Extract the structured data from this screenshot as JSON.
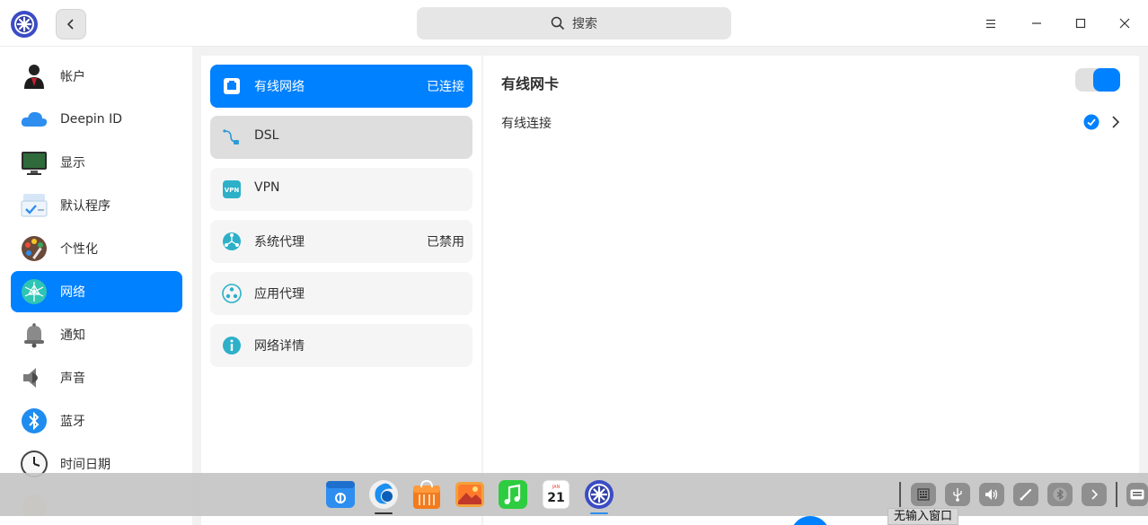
{
  "search": {
    "placeholder": "搜索"
  },
  "sidebar": {
    "items": [
      {
        "label": "帐户",
        "icon": "account-icon"
      },
      {
        "label": "Deepin ID",
        "icon": "cloud-icon"
      },
      {
        "label": "显示",
        "icon": "display-icon"
      },
      {
        "label": "默认程序",
        "icon": "default-apps-icon"
      },
      {
        "label": "个性化",
        "icon": "personalization-icon"
      },
      {
        "label": "网络",
        "icon": "network-icon",
        "active": true
      },
      {
        "label": "通知",
        "icon": "bell-icon"
      },
      {
        "label": "声音",
        "icon": "speaker-icon"
      },
      {
        "label": "蓝牙",
        "icon": "bluetooth-icon"
      },
      {
        "label": "时间日期",
        "icon": "clock-icon"
      }
    ]
  },
  "network_menu": {
    "items": [
      {
        "label": "有线网络",
        "status": "已连接",
        "icon": "wired-icon",
        "active": true
      },
      {
        "label": "DSL",
        "status": "",
        "icon": "dsl-icon"
      },
      {
        "label": "VPN",
        "status": "",
        "icon": "vpn-icon"
      },
      {
        "label": "系统代理",
        "status": "已禁用",
        "icon": "system-proxy-icon"
      },
      {
        "label": "应用代理",
        "status": "",
        "icon": "app-proxy-icon"
      },
      {
        "label": "网络详情",
        "status": "",
        "icon": "info-icon"
      }
    ]
  },
  "content": {
    "title": "有线网卡",
    "toggle_on": true,
    "connection_label": "有线连接",
    "connection_active": true
  },
  "dock": {
    "ime_tooltip": "无输入窗口",
    "calendar_month": "JAN",
    "calendar_day": "21"
  },
  "colors": {
    "accent": "#0081ff",
    "sidebar_bg": "#ffffff",
    "window_bg": "#f2f2f2"
  }
}
